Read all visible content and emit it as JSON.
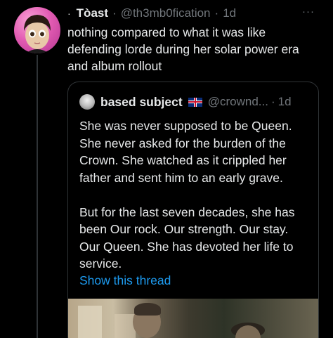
{
  "tweet": {
    "bullet": "·",
    "display_name": "Tòast",
    "handle": "@th3mb0fication",
    "separator": "·",
    "time": "1d",
    "more": "···",
    "text": "nothing compared to what it was like\ndefending lorde during her solar power era\nand album rollout",
    "avatar_icon": "avatar-girl-pink-background"
  },
  "quote": {
    "display_name": "based subject",
    "flag_icon": "uk-flag-icon",
    "handle": "@crownd...",
    "separator": "·",
    "time": "1d",
    "paragraph1": "She was never supposed to be Queen. She never asked for the burden of the Crown. She watched as it crippled her father and sent him to an early grave.",
    "paragraph2": "But for the last seven decades, she has been Our rock. Our strength. Our stay. Our Queen. She has devoted her life to service.",
    "show_thread": "Show this thread",
    "link_color": "#1d9bf0"
  },
  "colors": {
    "background": "#000000",
    "text": "#e7e9ea",
    "muted": "#71767b",
    "border": "#2f3336"
  }
}
